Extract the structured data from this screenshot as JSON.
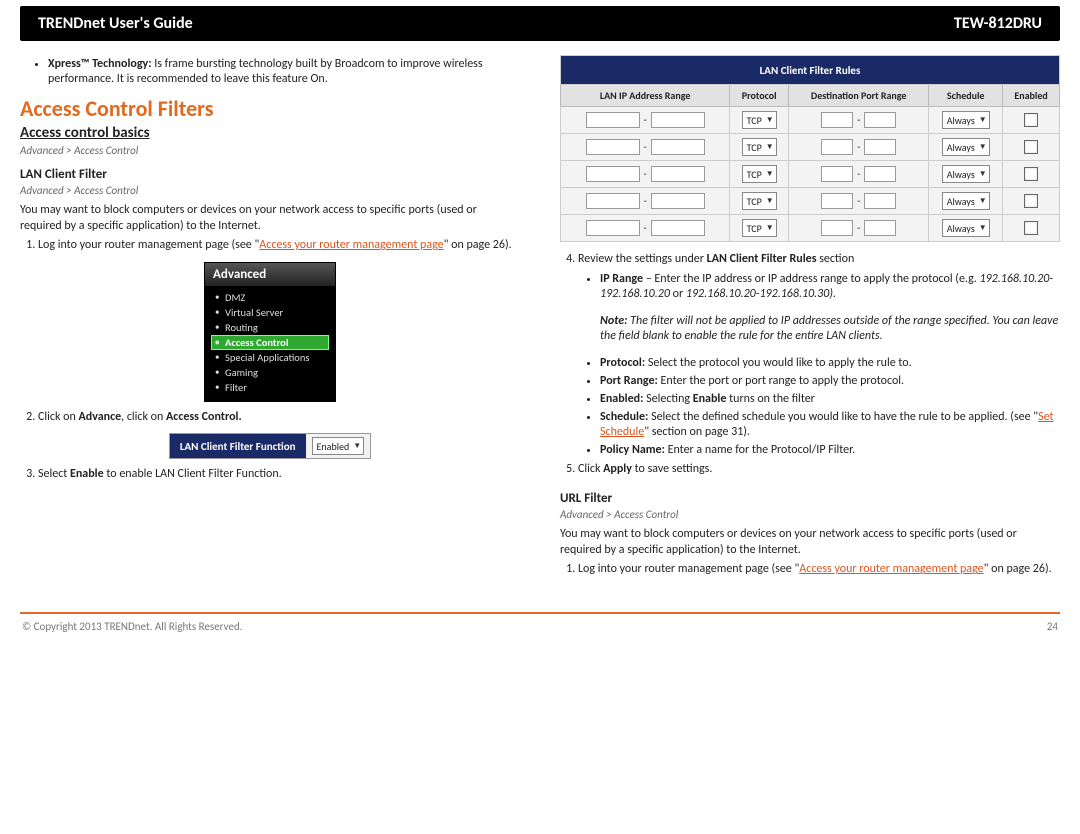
{
  "header": {
    "left": "TRENDnet User's Guide",
    "right": "TEW-812DRU"
  },
  "col1": {
    "xpress_label": "Xpress™ Technology:",
    "xpress_text": " Is frame bursting technology built by Broadcom to improve wireless performance. It is recommended to leave this feature On.",
    "h1": "Access Control Filters",
    "h2": "Access control basics",
    "bc1": "Advanced > Access Control",
    "h3a": "LAN Client Filter",
    "bc2": "Advanced > Access Control",
    "p1": "You may want to block computers or devices on your network access to specific ports (used or required by a specific application) to the Internet.",
    "step1_a": "Log into your router management page (see \"",
    "step1_link": "Access your router management page",
    "step1_b": "\" on page 26).",
    "adv_menu": {
      "title": "Advanced",
      "items": [
        "DMZ",
        "Virtual Server",
        "Routing",
        "Access Control",
        "Special Applications",
        "Gaming",
        "Filter"
      ],
      "active_index": 3
    },
    "step2_a": "Click on ",
    "step2_b1": "Advance",
    "step2_c": ", click on ",
    "step2_b2": "Access Control.",
    "lcf_bar": {
      "label": "LAN Client Filter Function",
      "value": "Enabled"
    },
    "step3_a": "Select ",
    "step3_b": "Enable",
    "step3_c": " to enable LAN Client Filter Function."
  },
  "col2": {
    "rules_title": "LAN Client Filter Rules",
    "headers": [
      "LAN IP Address Range",
      "Protocol",
      "Destination Port Range",
      "Schedule",
      "Enabled"
    ],
    "proto": "TCP",
    "sched": "Always",
    "rows": 5,
    "step4_a": "Review the settings under ",
    "step4_b": "LAN Client Filter Rules",
    "step4_c": " section",
    "b_ip_label": "IP Range",
    "b_ip_text": " – Enter the IP address or IP address range to apply the protocol (e.g. ",
    "b_ip_eg1": "192.168.10.20-192.168.10.20",
    "b_ip_or": " or ",
    "b_ip_eg2": "192.168.10.20-192.168.10.30).",
    "note_label": "Note:",
    "note_text": " The filter will not be applied to IP addresses outside of the range specified. You can leave the field blank to enable the rule for the entire LAN clients.",
    "b_proto_l": "Protocol:",
    "b_proto_t": " Select the protocol you would like to apply the rule to.",
    "b_pr_l": "Port Range:",
    "b_pr_t": " Enter the port or port range to apply the protocol.",
    "b_en_l": "Enabled:",
    "b_en_t1": " Selecting ",
    "b_en_b": "Enable",
    "b_en_t2": " turns on the filter",
    "b_sch_l": "Schedule:",
    "b_sch_t1": " Select the defined schedule you would like to have the rule to be applied. (see \"",
    "b_sch_link": "Set Schedule",
    "b_sch_t2": "\" section on page 31).",
    "b_pn_l": "Policy Name:",
    "b_pn_t": " Enter a name for the Protocol/IP Filter.",
    "step5_a": "Click ",
    "step5_b": "Apply",
    "step5_c": " to save settings.",
    "h3b": "URL Filter",
    "bc3": "Advanced > Access Control",
    "p2": "You may want to block computers or devices on your network access to specific ports (used or required by a specific application) to the Internet.",
    "u_step1_a": "Log into your router management page (see \"",
    "u_step1_link": "Access your router management page",
    "u_step1_b": "\" on page 26)."
  },
  "footer": {
    "copyright": "© Copyright 2013 TRENDnet. All Rights Reserved.",
    "page": "24"
  }
}
